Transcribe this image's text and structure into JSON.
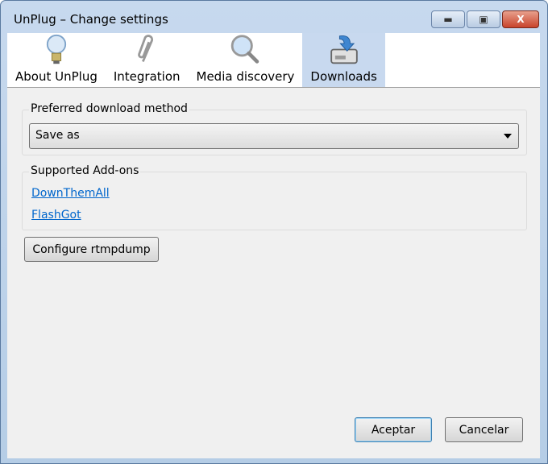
{
  "window": {
    "title": "UnPlug – Change settings",
    "minimize": "▬",
    "maximize": "▣",
    "close": "X"
  },
  "tabs": [
    {
      "label": "About UnPlug",
      "icon": "lightbulb-icon",
      "selected": false
    },
    {
      "label": "Integration",
      "icon": "paperclip-icon",
      "selected": false
    },
    {
      "label": "Media discovery",
      "icon": "magnifier-icon",
      "selected": false
    },
    {
      "label": "Downloads",
      "icon": "download-drive-icon",
      "selected": true
    }
  ],
  "preferred": {
    "label": "Preferred download method",
    "value": "Save as"
  },
  "addons": {
    "label": "Supported Add-ons",
    "links": [
      "DownThemAll",
      "FlashGot"
    ]
  },
  "configure_label": "Configure rtmpdump",
  "ok_label": "Aceptar",
  "cancel_label": "Cancelar"
}
